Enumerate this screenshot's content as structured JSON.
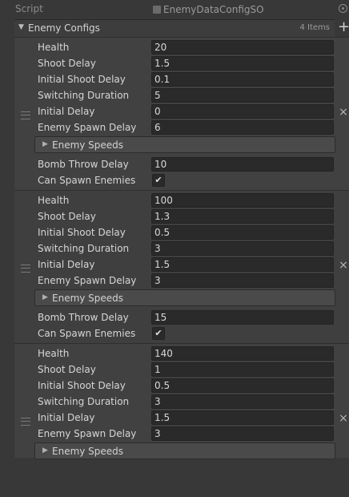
{
  "script_row": {
    "label": "Script",
    "value": "EnemyDataConfigSO"
  },
  "list": {
    "title": "Enemy Configs",
    "count": "4 Items"
  },
  "labels": {
    "health": "Health",
    "shoot_delay": "Shoot Delay",
    "initial_shoot_delay": "Initial Shoot Delay",
    "switching_duration": "Switching Duration",
    "initial_delay": "Initial Delay",
    "enemy_spawn_delay": "Enemy Spawn Delay",
    "enemy_speeds": "Enemy Speeds",
    "bomb_throw_delay": "Bomb Throw Delay",
    "can_spawn_enemies": "Can Spawn Enemies"
  },
  "elements": [
    {
      "health": "20",
      "shoot_delay": "1.5",
      "initial_shoot_delay": "0.1",
      "switching_duration": "5",
      "initial_delay": "0",
      "enemy_spawn_delay": "6",
      "bomb_throw_delay": "10",
      "can_spawn_enemies": "✔"
    },
    {
      "health": "100",
      "shoot_delay": "1.3",
      "initial_shoot_delay": "0.5",
      "switching_duration": "3",
      "initial_delay": "1.5",
      "enemy_spawn_delay": "3",
      "bomb_throw_delay": "15",
      "can_spawn_enemies": "✔"
    },
    {
      "health": "140",
      "shoot_delay": "1",
      "initial_shoot_delay": "0.5",
      "switching_duration": "3",
      "initial_delay": "1.5",
      "enemy_spawn_delay": "3"
    }
  ],
  "icons": {
    "collapse": "▼",
    "expand": "▶",
    "add": "+",
    "remove": "×"
  }
}
